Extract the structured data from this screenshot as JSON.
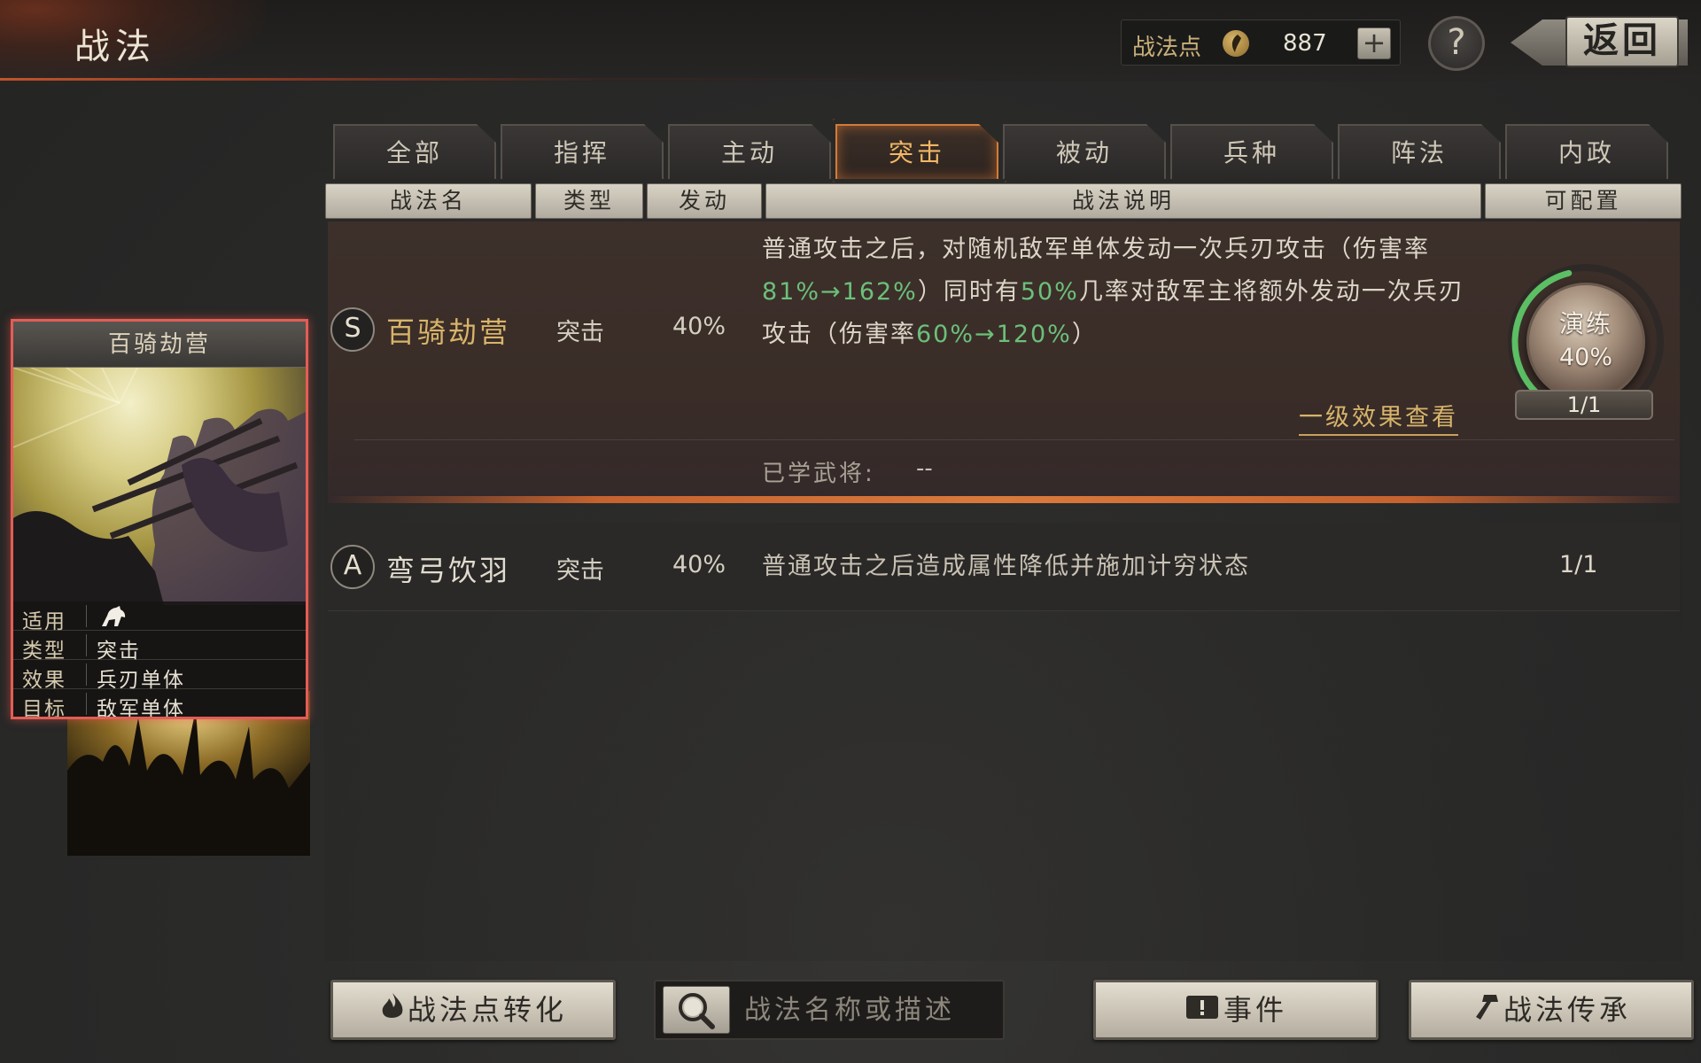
{
  "header": {
    "title": "战法",
    "points_label": "战法点",
    "points_value": "887",
    "add_label": "+",
    "help_label": "?",
    "back_label": "返回"
  },
  "tabs": [
    {
      "label": "全部"
    },
    {
      "label": "指挥"
    },
    {
      "label": "主动"
    },
    {
      "label": "突击",
      "active": true
    },
    {
      "label": "被动"
    },
    {
      "label": "兵种"
    },
    {
      "label": "阵法"
    },
    {
      "label": "内政"
    }
  ],
  "columns": [
    "战法名",
    "类型",
    "发动",
    "战法说明",
    "可配置"
  ],
  "skills": [
    {
      "grade": "S",
      "name": "百骑劫营",
      "type": "突击",
      "rate": "40%",
      "desc": {
        "p1": "普通攻击之后，对随机敌军单体发动一次兵刃攻击（伤害率",
        "g1": "81%→162%",
        "p2": "）同时有",
        "g2": "50%",
        "p3": "几率对敌军主将额外发动一次兵刃攻击（伤害率",
        "g3": "60%→120%",
        "p4": "）"
      },
      "level_link": "一级效果查看",
      "learned_label": "已学武将:",
      "learned_value": "--",
      "train_label": "演练",
      "train_rate": "40%",
      "train_progress": 0.4,
      "slots": "1/1"
    },
    {
      "grade": "A",
      "name": "弯弓饮羽",
      "type": "突击",
      "rate": "40%",
      "desc_text": "普通攻击之后造成属性降低并施加计穷状态",
      "slots": "1/1"
    }
  ],
  "card": {
    "title": "百骑劫营",
    "rows": [
      {
        "key": "适用",
        "value": "",
        "icon": "cavalry-icon"
      },
      {
        "key": "类型",
        "value": "突击"
      },
      {
        "key": "效果",
        "value": "兵刃单体"
      },
      {
        "key": "目标",
        "value": "敌军单体"
      }
    ]
  },
  "bottom": {
    "convert_label": "战法点转化",
    "search_placeholder": "战法名称或描述",
    "event_label": "事件",
    "inherit_label": "战法传承"
  },
  "colors": {
    "accent_orange": "#d27c37",
    "highlight_green": "#6cc07a",
    "name_gold": "#d8b46a",
    "card_border_red": "#e35d55",
    "train_ring_green": "#5cbf64"
  }
}
